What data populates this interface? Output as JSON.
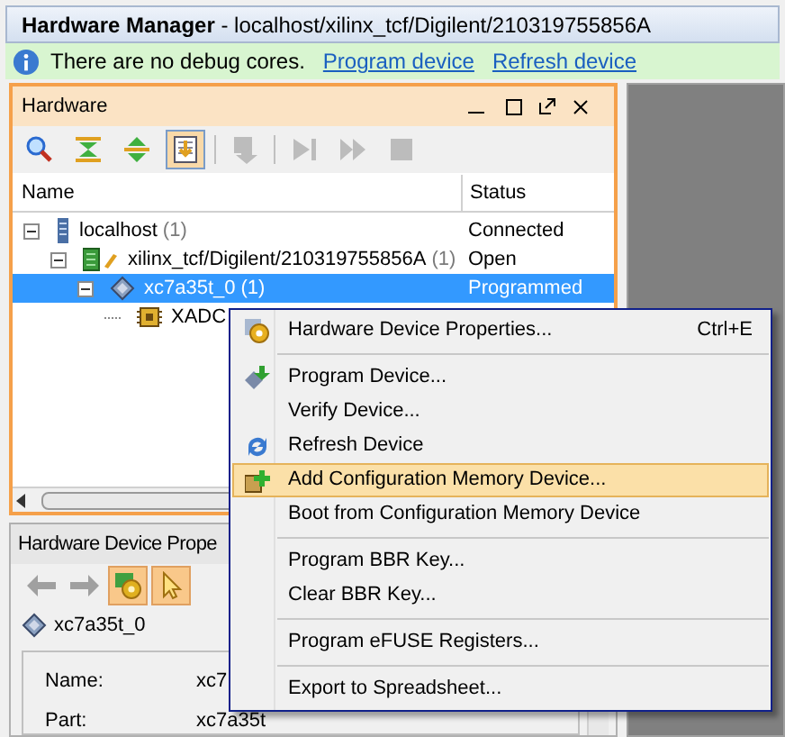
{
  "window": {
    "title": "Hardware Manager",
    "subtitle": " - localhost/xilinx_tcf/Digilent/210319755856A"
  },
  "info_bar": {
    "message": "There are no debug cores.",
    "links": [
      "Program device",
      "Refresh device"
    ]
  },
  "hardware_panel": {
    "title": "Hardware",
    "toolbar": [
      {
        "kind": "search",
        "active": false,
        "disabled": false
      },
      {
        "kind": "collapse",
        "active": false,
        "disabled": false
      },
      {
        "kind": "expand",
        "active": false,
        "disabled": false
      },
      {
        "kind": "autoconnect",
        "active": true,
        "disabled": false
      },
      {
        "kind": "download",
        "active": false,
        "disabled": true
      },
      {
        "kind": "step",
        "active": false,
        "disabled": true
      },
      {
        "kind": "run",
        "active": false,
        "disabled": true
      },
      {
        "kind": "stop",
        "active": false,
        "disabled": true
      }
    ],
    "columns": [
      "Name",
      "Status"
    ],
    "tree": [
      {
        "kind": "server",
        "name": "localhost",
        "count": "(1)",
        "status": "Connected",
        "selected": false,
        "expanded": true,
        "children": [
          {
            "kind": "target",
            "name": "xilinx_tcf/Digilent/210319755856A",
            "count": "(1)",
            "status": "Open",
            "selected": false,
            "expanded": true,
            "children": [
              {
                "kind": "device",
                "name": "xc7a35t_0",
                "count": "(1)",
                "status": "Programmed",
                "selected": true,
                "expanded": true,
                "children": [
                  {
                    "kind": "xadc",
                    "name": "XADC",
                    "selected": false
                  }
                ]
              }
            ]
          }
        ]
      }
    ]
  },
  "properties_panel": {
    "title": "Hardware Device Prope",
    "toolbar": [
      {
        "kind": "back",
        "active": false
      },
      {
        "kind": "forward",
        "active": false
      },
      {
        "kind": "device-props",
        "active": true
      },
      {
        "kind": "pointer",
        "active": true
      }
    ],
    "device": "xc7a35t_0",
    "fields": [
      {
        "label": "Name:",
        "value": "xc7"
      },
      {
        "label": "Part:",
        "value": "xc7a35t"
      }
    ]
  },
  "context_menu": [
    {
      "kind": "properties",
      "label": "Hardware Device Properties...",
      "shortcut": "Ctrl+E",
      "highlighted": false
    },
    {
      "kind": "separator"
    },
    {
      "kind": "program",
      "label": "Program Device...",
      "highlighted": false
    },
    {
      "kind": "item",
      "label": "Verify Device...",
      "highlighted": false
    },
    {
      "kind": "refresh",
      "label": "Refresh Device",
      "highlighted": false
    },
    {
      "kind": "addmemory",
      "label": "Add Configuration Memory Device...",
      "highlighted": true
    },
    {
      "kind": "item",
      "label": "Boot from Configuration Memory Device",
      "highlighted": false
    },
    {
      "kind": "separator"
    },
    {
      "kind": "item",
      "label": "Program BBR Key...",
      "highlighted": false
    },
    {
      "kind": "item",
      "label": "Clear BBR Key...",
      "highlighted": false
    },
    {
      "kind": "separator"
    },
    {
      "kind": "item",
      "label": "Program eFUSE Registers...",
      "highlighted": false
    },
    {
      "kind": "separator"
    },
    {
      "kind": "item",
      "label": "Export to Spreadsheet...",
      "highlighted": false
    }
  ]
}
